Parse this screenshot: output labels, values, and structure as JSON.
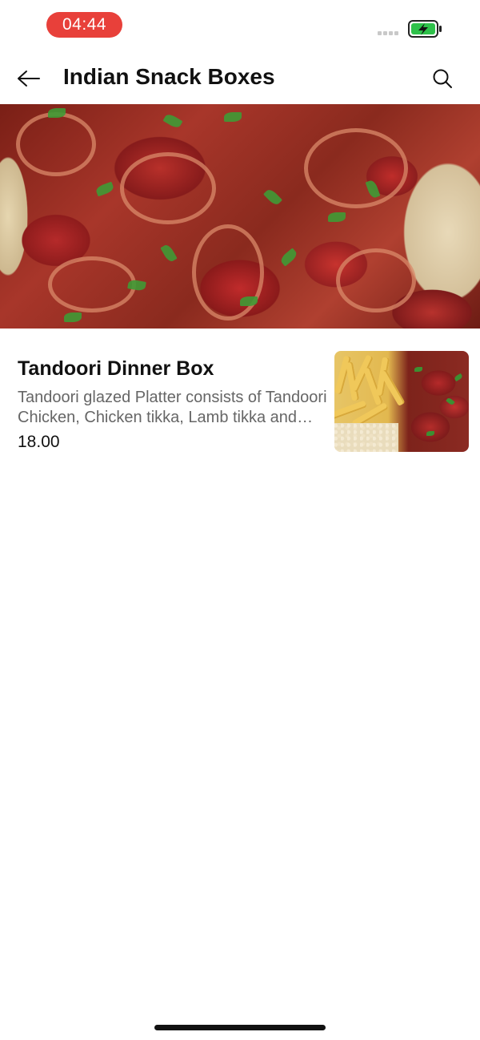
{
  "status_bar": {
    "time": "04:44",
    "time_pill_color": "#e8403a",
    "battery_color": "#2ec14a",
    "battery_state": "charging"
  },
  "header": {
    "title": "Indian Snack Boxes",
    "back_icon": "arrow-left-icon",
    "search_icon": "search-icon"
  },
  "hero": {
    "image": "tandoori-platter-photo"
  },
  "items": [
    {
      "name": "Tandoori Dinner Box",
      "description": "Tandoori glazed Platter consists of Tandoori Chicken, Chicken tikka, Lamb tikka and more",
      "price": "18.00",
      "thumbnail": "tandoori-fries-rice-photo"
    }
  ]
}
